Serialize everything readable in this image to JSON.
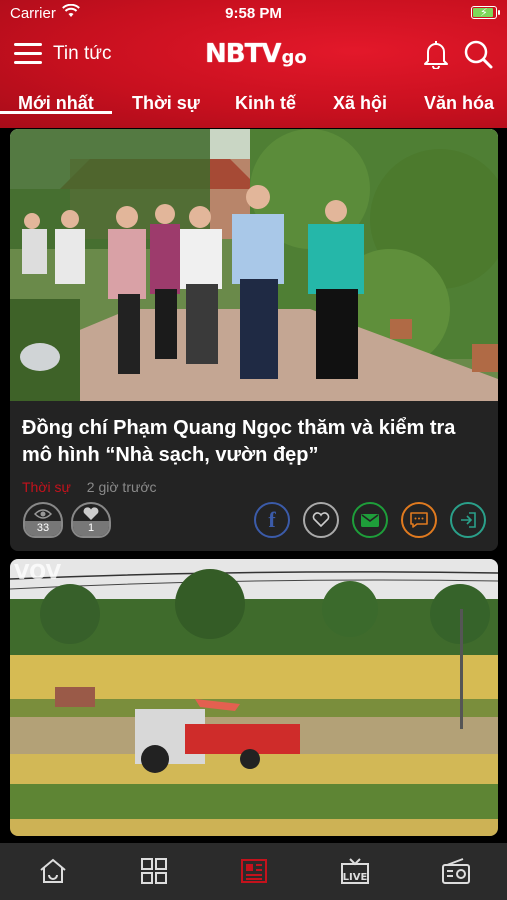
{
  "status": {
    "carrier": "Carrier",
    "time": "9:58 PM"
  },
  "header": {
    "section": "Tin tức",
    "logo_main": "NBTV",
    "logo_sub": "go"
  },
  "tabs": [
    {
      "label": "Mới nhất",
      "active": true
    },
    {
      "label": "Thời sự"
    },
    {
      "label": "Kinh tế"
    },
    {
      "label": "Xã hội"
    },
    {
      "label": "Văn hóa"
    }
  ],
  "articles": [
    {
      "title": "Đồng chí Phạm Quang Ngọc thăm và kiểm tra mô hình “Nhà sạch, vườn đẹp”",
      "category": "Thời sự",
      "time_ago": "2 giờ trước",
      "views": "33",
      "likes": "1"
    },
    {
      "watermark": "VOV"
    }
  ],
  "colors": {
    "brand_red": "#c8101f",
    "facebook": "#3b5ba9",
    "email": "#1e9e3a",
    "comment": "#e07a1f",
    "share": "#2aa08a"
  },
  "bottom_nav": [
    "home-icon",
    "grid-icon",
    "newspaper-icon",
    "live-tv-icon",
    "radio-icon"
  ]
}
